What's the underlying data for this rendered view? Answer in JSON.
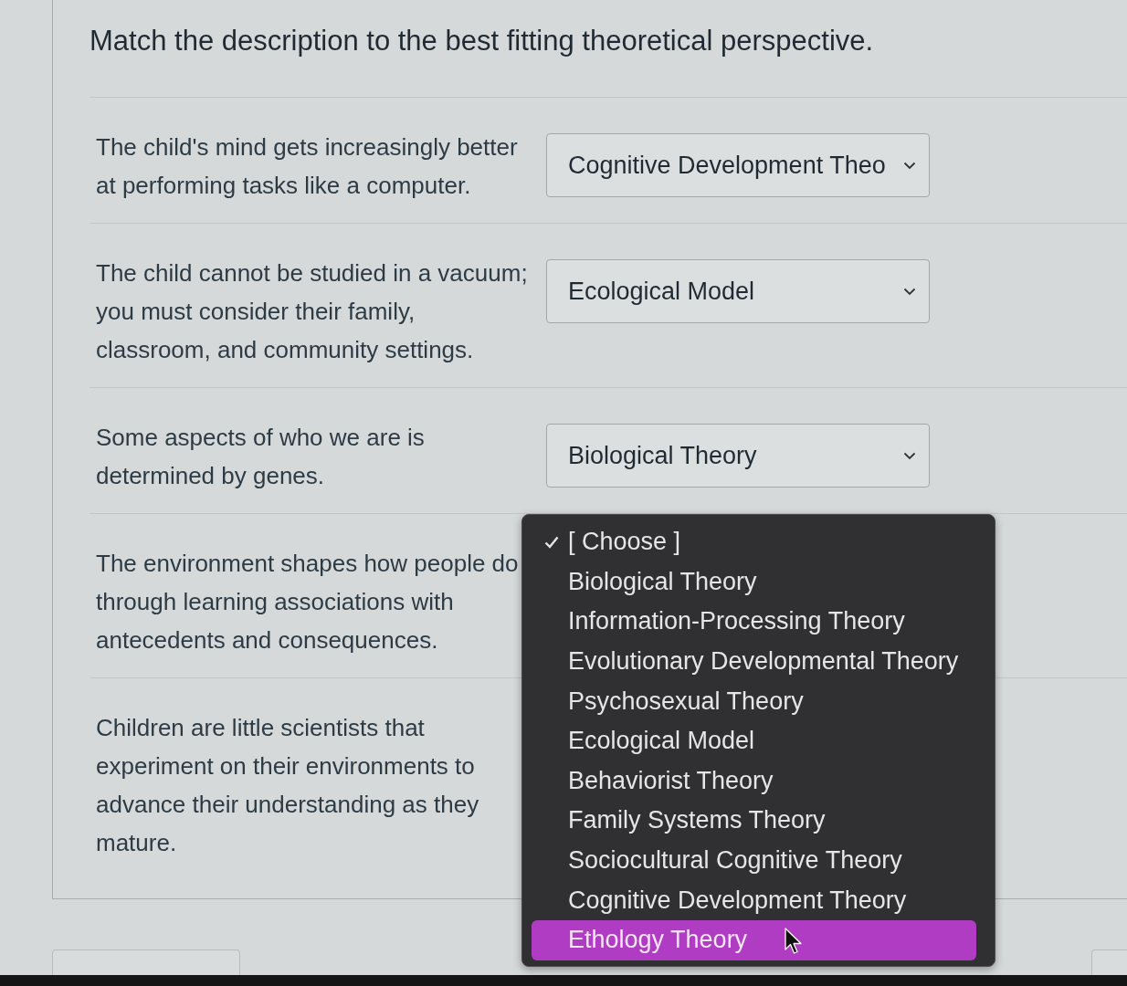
{
  "question": {
    "prompt": "Match the description to the best fitting theoretical perspective."
  },
  "rows": [
    {
      "description": "The child's mind gets increasingly better\nat performing tasks like a computer.",
      "answer": "Cognitive Development Theo"
    },
    {
      "description": "The child cannot be studied in a vacuum;\nyou must consider their family,\nclassroom, and community settings.",
      "answer": "Ecological Model"
    },
    {
      "description": "Some aspects of who we are is\ndetermined by genes.",
      "answer": "Biological Theory"
    },
    {
      "description": "The environment shapes how people do\nthrough learning associations with\nantecedents and consequences."
    },
    {
      "description": "Children are little scientists that\nexperiment on their environments to\nadvance their understanding as they\nmature."
    }
  ],
  "open_dropdown": {
    "options": [
      {
        "label": "[ Choose ]",
        "selected": true,
        "highlighted": false
      },
      {
        "label": "Biological Theory",
        "selected": false,
        "highlighted": false
      },
      {
        "label": "Information-Processing Theory",
        "selected": false,
        "highlighted": false
      },
      {
        "label": "Evolutionary Developmental Theory",
        "selected": false,
        "highlighted": false
      },
      {
        "label": "Psychosexual Theory",
        "selected": false,
        "highlighted": false
      },
      {
        "label": "Ecological Model",
        "selected": false,
        "highlighted": false
      },
      {
        "label": "Behaviorist Theory",
        "selected": false,
        "highlighted": false
      },
      {
        "label": "Family Systems Theory",
        "selected": false,
        "highlighted": false
      },
      {
        "label": "Sociocultural Cognitive Theory",
        "selected": false,
        "highlighted": false
      },
      {
        "label": "Cognitive Development Theory",
        "selected": false,
        "highlighted": false
      },
      {
        "label": "Ethology Theory",
        "selected": false,
        "highlighted": true
      }
    ]
  }
}
